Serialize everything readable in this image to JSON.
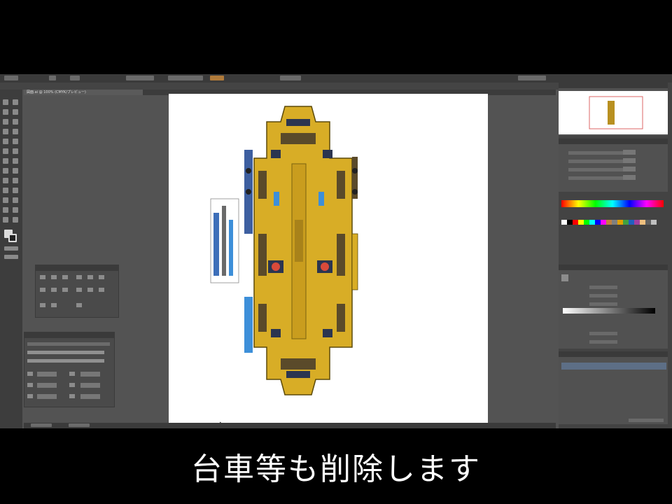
{
  "subtitle": "台車等も削除します",
  "document_tab": "図面.ai @ 100% (CMYK/プレビュー)",
  "colors": {
    "loco_body": "#d8ad26",
    "loco_dark": "#5a4a2a",
    "loco_outline": "#5c4a0a",
    "window": "#2b3550",
    "accent_blue": "#3d8fd9",
    "ui_dark": "#3d3d3d",
    "ui_mid": "#535353",
    "artboard": "#ffffff"
  },
  "icons": [
    "selection-tool-icon",
    "direct-selection-tool-icon",
    "pen-tool-icon",
    "type-tool-icon",
    "rectangle-tool-icon",
    "brush-tool-icon",
    "zoom-tool-icon",
    "hand-tool-icon"
  ],
  "swatch_colors": [
    "#ffffff",
    "#000000",
    "#ff0000",
    "#ffff00",
    "#00ff00",
    "#00ffff",
    "#0000ff",
    "#ff00ff",
    "#c08040",
    "#808080",
    "#e0a000",
    "#40a040",
    "#2060c0",
    "#a040a0",
    "#f0c080",
    "#606060",
    "#c0c0c0"
  ]
}
